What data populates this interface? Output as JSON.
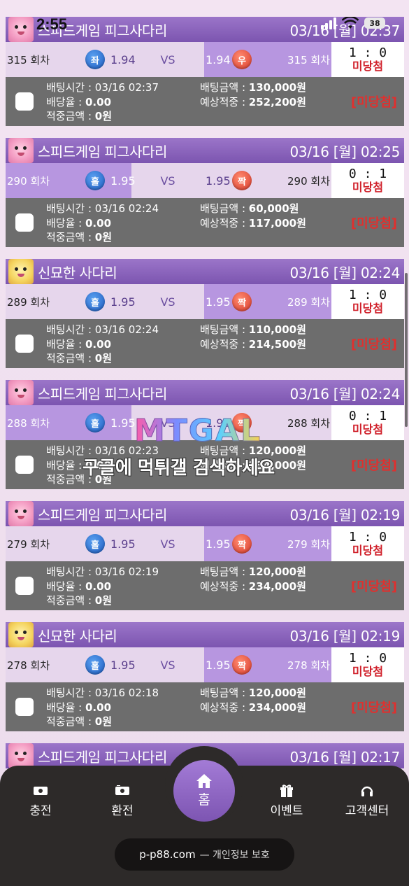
{
  "status_bar": {
    "time": "2:55",
    "battery": "38"
  },
  "labels": {
    "vs": "VS",
    "bet_time": "배팅시간 : ",
    "odds": "배당율 : ",
    "win_amount": "적중금액 : ",
    "bet_amount": "배팅금액 : ",
    "expected": "예상적중 : "
  },
  "cards": [
    {
      "game": "스피드게임 피그사다리",
      "avatar": "pink",
      "datetime": "03/16 [월] 02:37",
      "left": {
        "round": "315 회차",
        "badge": "좌",
        "badge_color": "blue",
        "odds": "1.94",
        "picked": false
      },
      "right": {
        "round": "315 회차",
        "badge": "우",
        "badge_color": "red",
        "odds": "1.94",
        "picked": true
      },
      "score": "1 : 0",
      "status": "미당첨",
      "bet_time": "03/16 02:37",
      "rate": "0.00",
      "win_amount": "0원",
      "bet_amount": "130,000원",
      "expected": "252,200원",
      "result": "[미당첨]"
    },
    {
      "game": "스피드게임 피그사다리",
      "avatar": "pink",
      "datetime": "03/16 [월] 02:25",
      "left": {
        "round": "290 회차",
        "badge": "홀",
        "badge_color": "blue",
        "odds": "1.95",
        "picked": true
      },
      "right": {
        "round": "290 회차",
        "badge": "짝",
        "badge_color": "red",
        "odds": "1.95",
        "picked": false
      },
      "score": "0 : 1",
      "status": "미당첨",
      "bet_time": "03/16 02:24",
      "rate": "0.00",
      "win_amount": "0원",
      "bet_amount": "60,000원",
      "expected": "117,000원",
      "result": "[미당첨]"
    },
    {
      "game": "신묘한 사다리",
      "avatar": "yellow",
      "datetime": "03/16 [월] 02:24",
      "left": {
        "round": "289 회차",
        "badge": "홀",
        "badge_color": "blue",
        "odds": "1.95",
        "picked": false
      },
      "right": {
        "round": "289 회차",
        "badge": "짝",
        "badge_color": "red",
        "odds": "1.95",
        "picked": true
      },
      "score": "1 : 0",
      "status": "미당첨",
      "bet_time": "03/16 02:24",
      "rate": "0.00",
      "win_amount": "0원",
      "bet_amount": "110,000원",
      "expected": "214,500원",
      "result": "[미당첨]"
    },
    {
      "game": "스피드게임 피그사다리",
      "avatar": "pink",
      "datetime": "03/16 [월] 02:24",
      "left": {
        "round": "288 회차",
        "badge": "홀",
        "badge_color": "blue",
        "odds": "1.95",
        "picked": true
      },
      "right": {
        "round": "288 회차",
        "badge": "짝",
        "badge_color": "red",
        "odds": "1.95",
        "picked": false
      },
      "score": "0 : 1",
      "status": "미당첨",
      "bet_time": "03/16 02:23",
      "rate": "0.00",
      "win_amount": "0원",
      "bet_amount": "120,000원",
      "expected": "234,000원",
      "result": "[미당첨]"
    },
    {
      "game": "스피드게임 피그사다리",
      "avatar": "pink",
      "datetime": "03/16 [월] 02:19",
      "left": {
        "round": "279 회차",
        "badge": "홀",
        "badge_color": "blue",
        "odds": "1.95",
        "picked": false
      },
      "right": {
        "round": "279 회차",
        "badge": "짝",
        "badge_color": "red",
        "odds": "1.95",
        "picked": true
      },
      "score": "1 : 0",
      "status": "미당첨",
      "bet_time": "03/16 02:19",
      "rate": "0.00",
      "win_amount": "0원",
      "bet_amount": "120,000원",
      "expected": "234,000원",
      "result": "[미당첨]"
    },
    {
      "game": "신묘한 사다리",
      "avatar": "yellow",
      "datetime": "03/16 [월] 02:19",
      "left": {
        "round": "278 회차",
        "badge": "홀",
        "badge_color": "blue",
        "odds": "1.95",
        "picked": false
      },
      "right": {
        "round": "278 회차",
        "badge": "짝",
        "badge_color": "red",
        "odds": "1.95",
        "picked": true
      },
      "score": "1 : 0",
      "status": "미당첨",
      "bet_time": "03/16 02:18",
      "rate": "0.00",
      "win_amount": "0원",
      "bet_amount": "120,000원",
      "expected": "234,000원",
      "result": "[미당첨]"
    },
    {
      "game": "스피드게임 피그사다리",
      "avatar": "pink",
      "datetime": "03/16 [월] 02:17"
    }
  ],
  "watermark": {
    "logo": "MTGAL",
    "text": "구글에 먹튀갤 검색하세요"
  },
  "bottom_nav": {
    "charge": "충전",
    "exchange": "환전",
    "home": "홈",
    "event": "이벤트",
    "support": "고객센터"
  },
  "browser": {
    "url": "p-p88.com",
    "privacy": "— 개인정보 보호"
  },
  "colors": {
    "header": "#7c55b0",
    "picked": "#b796e0",
    "lost": "#d0202a",
    "bet_bg": "#6d6d6d"
  }
}
